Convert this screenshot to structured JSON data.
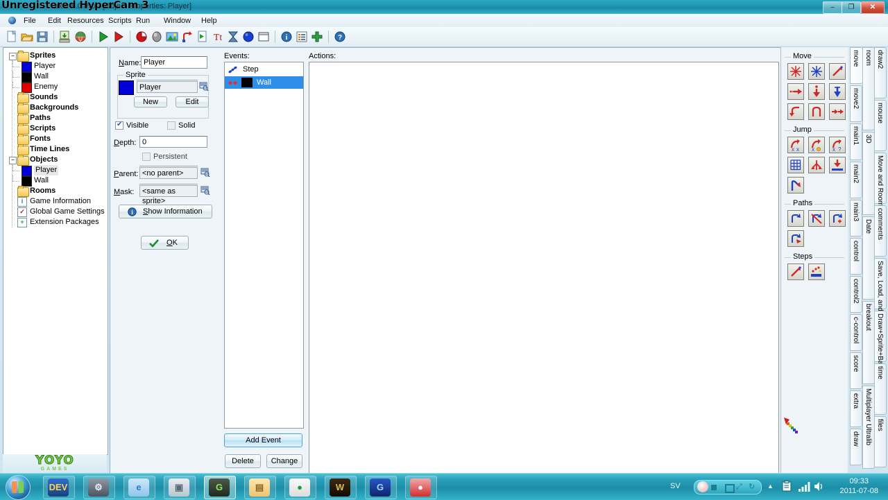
{
  "window": {
    "title": "aker 8.0 Pro - [Object Properties: Player]",
    "watermark": "Unregistered HyperCam 3",
    "controls": {
      "minimize": "–",
      "maximize": "❐",
      "close": "✕"
    },
    "mdi_controls": {
      "minimize": "–",
      "maximize": "❐",
      "close": "✕"
    }
  },
  "menu": {
    "items": [
      "File",
      "Edit",
      "Resources",
      "Scripts",
      "Run",
      "Window",
      "Help"
    ]
  },
  "toolbar": {
    "icons": [
      "new-file-icon",
      "open-folder-icon",
      "save-icon",
      "separator",
      "create-executable-icon",
      "publish-globe-icon",
      "separator",
      "run-game-icon",
      "run-debug-icon",
      "separator",
      "add-sprite-icon",
      "add-sound-icon",
      "add-background-icon",
      "add-path-icon",
      "add-script-icon",
      "add-font-icon",
      "add-timeline-icon",
      "add-object-icon",
      "add-room-icon",
      "separator",
      "game-information-icon",
      "global-game-settings-icon",
      "extension-packages-icon",
      "separator",
      "help-icon"
    ]
  },
  "tree": {
    "nodes": [
      {
        "label": "Sprites",
        "type": "folder",
        "depth": 0,
        "expander": "−",
        "bold": true
      },
      {
        "label": "Player",
        "type": "swatch",
        "depth": 1,
        "color": "#0000d8"
      },
      {
        "label": "Wall",
        "type": "swatch",
        "depth": 1,
        "color": "#000000"
      },
      {
        "label": "Enemy",
        "type": "swatch",
        "depth": 1,
        "color": "#e00000"
      },
      {
        "label": "Sounds",
        "type": "folder",
        "depth": 0,
        "bold": true
      },
      {
        "label": "Backgrounds",
        "type": "folder",
        "depth": 0,
        "bold": true
      },
      {
        "label": "Paths",
        "type": "folder",
        "depth": 0,
        "bold": true
      },
      {
        "label": "Scripts",
        "type": "folder",
        "depth": 0,
        "bold": true
      },
      {
        "label": "Fonts",
        "type": "folder",
        "depth": 0,
        "bold": true
      },
      {
        "label": "Time Lines",
        "type": "folder",
        "depth": 0,
        "bold": true
      },
      {
        "label": "Objects",
        "type": "folder",
        "depth": 0,
        "expander": "−",
        "bold": true
      },
      {
        "label": "Player",
        "type": "swatch",
        "depth": 1,
        "color": "#0000d8",
        "selected": true
      },
      {
        "label": "Wall",
        "type": "swatch",
        "depth": 1,
        "color": "#000000"
      },
      {
        "label": "Rooms",
        "type": "folder",
        "depth": 0,
        "bold": true
      },
      {
        "label": "Game Information",
        "type": "info",
        "depth": 0,
        "glyph": "i"
      },
      {
        "label": "Global Game Settings",
        "type": "check",
        "depth": 0,
        "glyph": "✓"
      },
      {
        "label": "Extension Packages",
        "type": "plus",
        "depth": 0,
        "glyph": "+"
      }
    ]
  },
  "branding": {
    "logo_main": "YOYO",
    "logo_sub": "GAMES"
  },
  "properties": {
    "name_label": "Name:",
    "name_value": "Player",
    "sprite_group_title": "Sprite",
    "sprite_value": "Player",
    "sprite_color": "#0000d8",
    "new_button": "New",
    "edit_button": "Edit",
    "visible_label": "Visible",
    "visible_checked": true,
    "solid_label": "Solid",
    "solid_checked": false,
    "depth_label": "Depth:",
    "depth_value": "0",
    "persistent_label": "Persistent",
    "persistent_checked": false,
    "parent_label": "Parent:",
    "parent_value": "<no parent>",
    "mask_label": "Mask:",
    "mask_value": "<same as sprite>",
    "show_information_button": "Show Information",
    "ok_button": "OK"
  },
  "events": {
    "header": "Events:",
    "items": [
      {
        "label": "Step",
        "icon": "step-event-icon",
        "selected": false,
        "swatch": null
      },
      {
        "label": "Wall",
        "icon": "collision-event-icon",
        "selected": true,
        "swatch": "#000000"
      }
    ],
    "add_event_button": "Add Event",
    "delete_button": "Delete",
    "change_button": "Change"
  },
  "actions": {
    "header": "Actions:",
    "items": []
  },
  "palette": {
    "groups": [
      {
        "title": "Move",
        "buttons": [
          "move-fixed-icon",
          "move-free-icon",
          "move-towards-icon",
          "speed-horizontal-icon",
          "speed-vertical-icon",
          "set-gravity-icon",
          "reverse-horizontal-icon",
          "reverse-vertical-icon",
          "set-friction-icon"
        ]
      },
      {
        "title": "Jump",
        "buttons": [
          "jump-position-icon",
          "jump-start-icon",
          "jump-random-icon",
          "align-to-grid-icon",
          "wrap-screen-icon",
          "move-to-contact-icon",
          "bounce-icon"
        ]
      },
      {
        "title": "Paths",
        "buttons": [
          "set-path-icon",
          "end-path-icon",
          "path-position-icon",
          "path-speed-icon"
        ]
      },
      {
        "title": "Steps",
        "buttons": [
          "step-towards-icon",
          "step-avoiding-icon"
        ]
      }
    ],
    "decoration_icon": "rainbow-comet-icon"
  },
  "tab_columns": [
    {
      "name": "inner",
      "tabs": [
        "move",
        "move2",
        "main1",
        "main2",
        "main3",
        "control",
        "control2",
        "c-control",
        "score",
        "extra",
        "draw"
      ],
      "active": "move"
    },
    {
      "name": "middle",
      "tabs": [
        "room",
        "3D",
        "Date",
        "breakout",
        "Multiplayer Ultralib"
      ],
      "active": null
    },
    {
      "name": "outer",
      "tabs": [
        "draw2",
        "mouse",
        "Move and Room",
        "comments",
        "Save, Load, and Mouse",
        "Draw+Sprite+Background",
        "time",
        "files"
      ],
      "active": null
    }
  ],
  "taskbar": {
    "start_label": "start-orb",
    "buttons": [
      {
        "name": "dev-cpp",
        "glyph": "DEV",
        "active": false
      },
      {
        "name": "settings-gear",
        "glyph": "⚙",
        "active": false
      },
      {
        "name": "internet-explorer",
        "glyph": "e",
        "active": false
      },
      {
        "name": "hypercam",
        "glyph": "▣",
        "active": false
      },
      {
        "name": "game-maker",
        "glyph": "G",
        "active": true
      },
      {
        "name": "file-explorer",
        "glyph": "▤",
        "active": false
      },
      {
        "name": "google-chrome",
        "glyph": "●",
        "active": false
      },
      {
        "name": "world-of-warcraft",
        "glyph": "W",
        "active": false
      },
      {
        "name": "gamex",
        "glyph": "G",
        "active": false
      },
      {
        "name": "record-app",
        "glyph": "●",
        "active": false
      }
    ],
    "language": "SV",
    "tray_icons": [
      "show-hidden-icon",
      "action-center-icon",
      "network-icon",
      "volume-icon"
    ],
    "clock_time": "09:33",
    "clock_date": "2011-07-08"
  },
  "colors": {
    "accent_teal": "#1d8da6",
    "selection_blue": "#2f8fe8",
    "titlebar": "#1c93b2"
  }
}
